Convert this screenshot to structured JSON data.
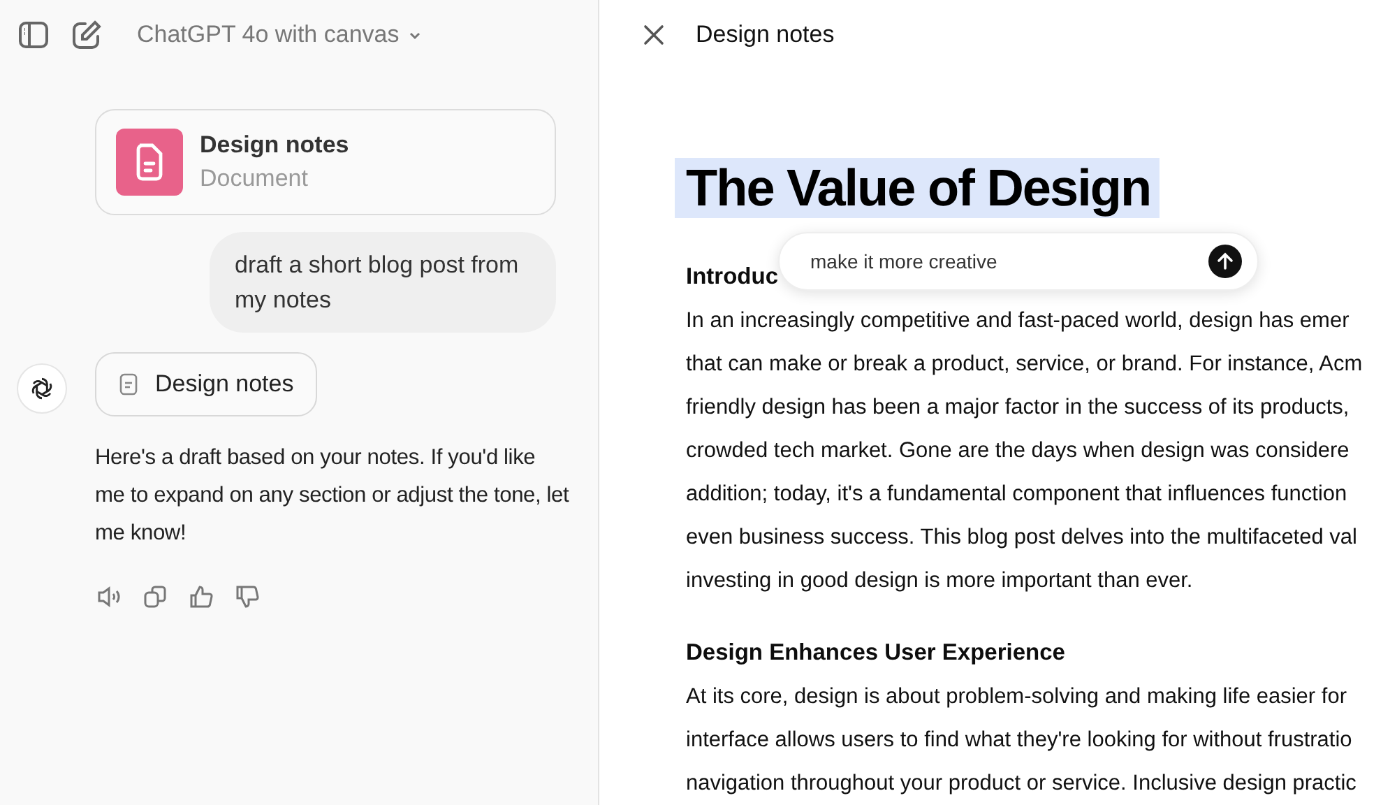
{
  "chat": {
    "model": "ChatGPT 4o with canvas",
    "document_card": {
      "title": "Design notes",
      "subtitle": "Document"
    },
    "user_message": "draft a short blog post from my notes",
    "assistant": {
      "document_chip": "Design notes",
      "message": "Here's a draft based on your notes. If you'd like me to expand on any section or adjust the tone, let me know!"
    }
  },
  "canvas": {
    "title": "Design notes",
    "document_title": "The Value of Design",
    "prompt_value": "make it more creative",
    "sections": [
      {
        "heading": "Introduc",
        "lines": [
          "In an increasingly competitive and fast-paced world, design has emer",
          "that can make or break a product, service, or brand. For instance, Acm",
          "friendly design has been a major factor in the success of its products,",
          "crowded tech market. Gone are the days when design was considere",
          "addition; today, it's a fundamental component that influences function",
          "even business success. This blog post delves into the multifaceted val",
          "investing in good design is more important than ever."
        ]
      },
      {
        "heading": "Design Enhances User Experience",
        "lines": [
          "At its core, design is about problem-solving and making life easier for",
          "interface allows users to find what they're looking for without frustratio",
          "navigation throughout your product or service. Inclusive design practic"
        ]
      }
    ]
  }
}
